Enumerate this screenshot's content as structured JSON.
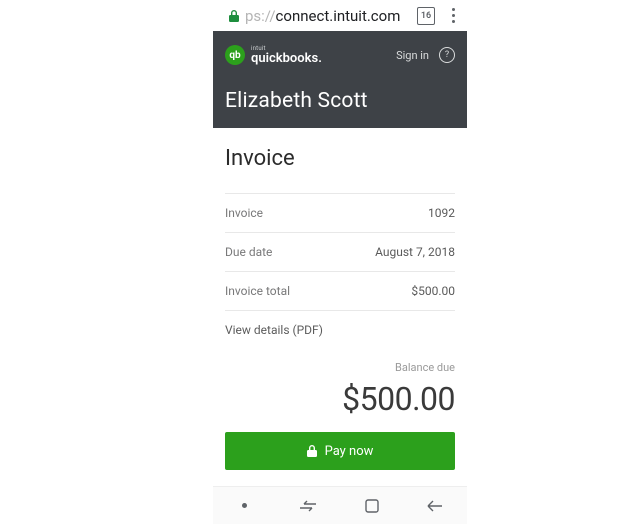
{
  "browser": {
    "url_prefix": "ps://",
    "url_host": "connect.intuit.com",
    "tab_count": "16"
  },
  "header": {
    "brand": "intuit",
    "product": "quickbooks.",
    "signin": "Sign in",
    "recipient": "Elizabeth Scott"
  },
  "invoice": {
    "title": "Invoice",
    "rows": [
      {
        "label": "Invoice",
        "value": "1092"
      },
      {
        "label": "Due date",
        "value": "August 7, 2018"
      },
      {
        "label": "Invoice total",
        "value": "$500.00"
      }
    ],
    "details_link": "View details (PDF)",
    "balance_label": "Balance due",
    "balance": "$500.00",
    "pay_label": "Pay now"
  }
}
